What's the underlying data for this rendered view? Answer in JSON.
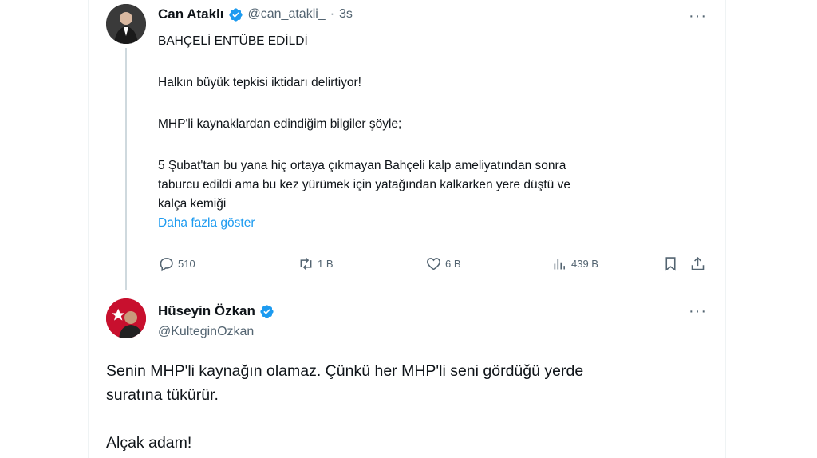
{
  "tweet": {
    "author_name": "Can Ataklı",
    "handle": "@can_atakli_",
    "separator": "·",
    "time": "3s",
    "lines": {
      "title": "BAHÇELİ ENTÜBE EDİLDİ",
      "line1": "Halkın büyük tepkisi iktidarı delirtiyor!",
      "line2": "MHP'li kaynaklardan edindiğim bilgiler şöyle;",
      "line3a": "5 Şubat'tan bu yana hiç ortaya çıkmayan Bahçeli kalp ameliyatından sonra",
      "line3b": "taburcu edildi ama bu kez yürümek için yatağından kalkarken yere düştü ve",
      "line3c": "kalça kemiği"
    },
    "show_more": "Daha fazla göster",
    "stats": {
      "replies": "510",
      "reposts": "1 B",
      "likes": "6 B",
      "views": "439 B"
    }
  },
  "reply": {
    "author_name": "Hüseyin Özkan",
    "handle": "@KulteginOzkan",
    "lines": {
      "line1": "Senin MHP'li kaynağın olamaz. Çünkü her MHP'li seni gördüğü yerde",
      "line2": "suratına tükürür.",
      "line3": "Alçak adam!"
    }
  },
  "colors": {
    "accent": "#1d9bf0",
    "text": "#0f1419",
    "muted": "#536471"
  },
  "icons": [
    "verified-badge-icon",
    "more-icon",
    "reply-icon",
    "repost-icon",
    "like-icon",
    "views-icon",
    "bookmark-icon",
    "share-icon"
  ]
}
